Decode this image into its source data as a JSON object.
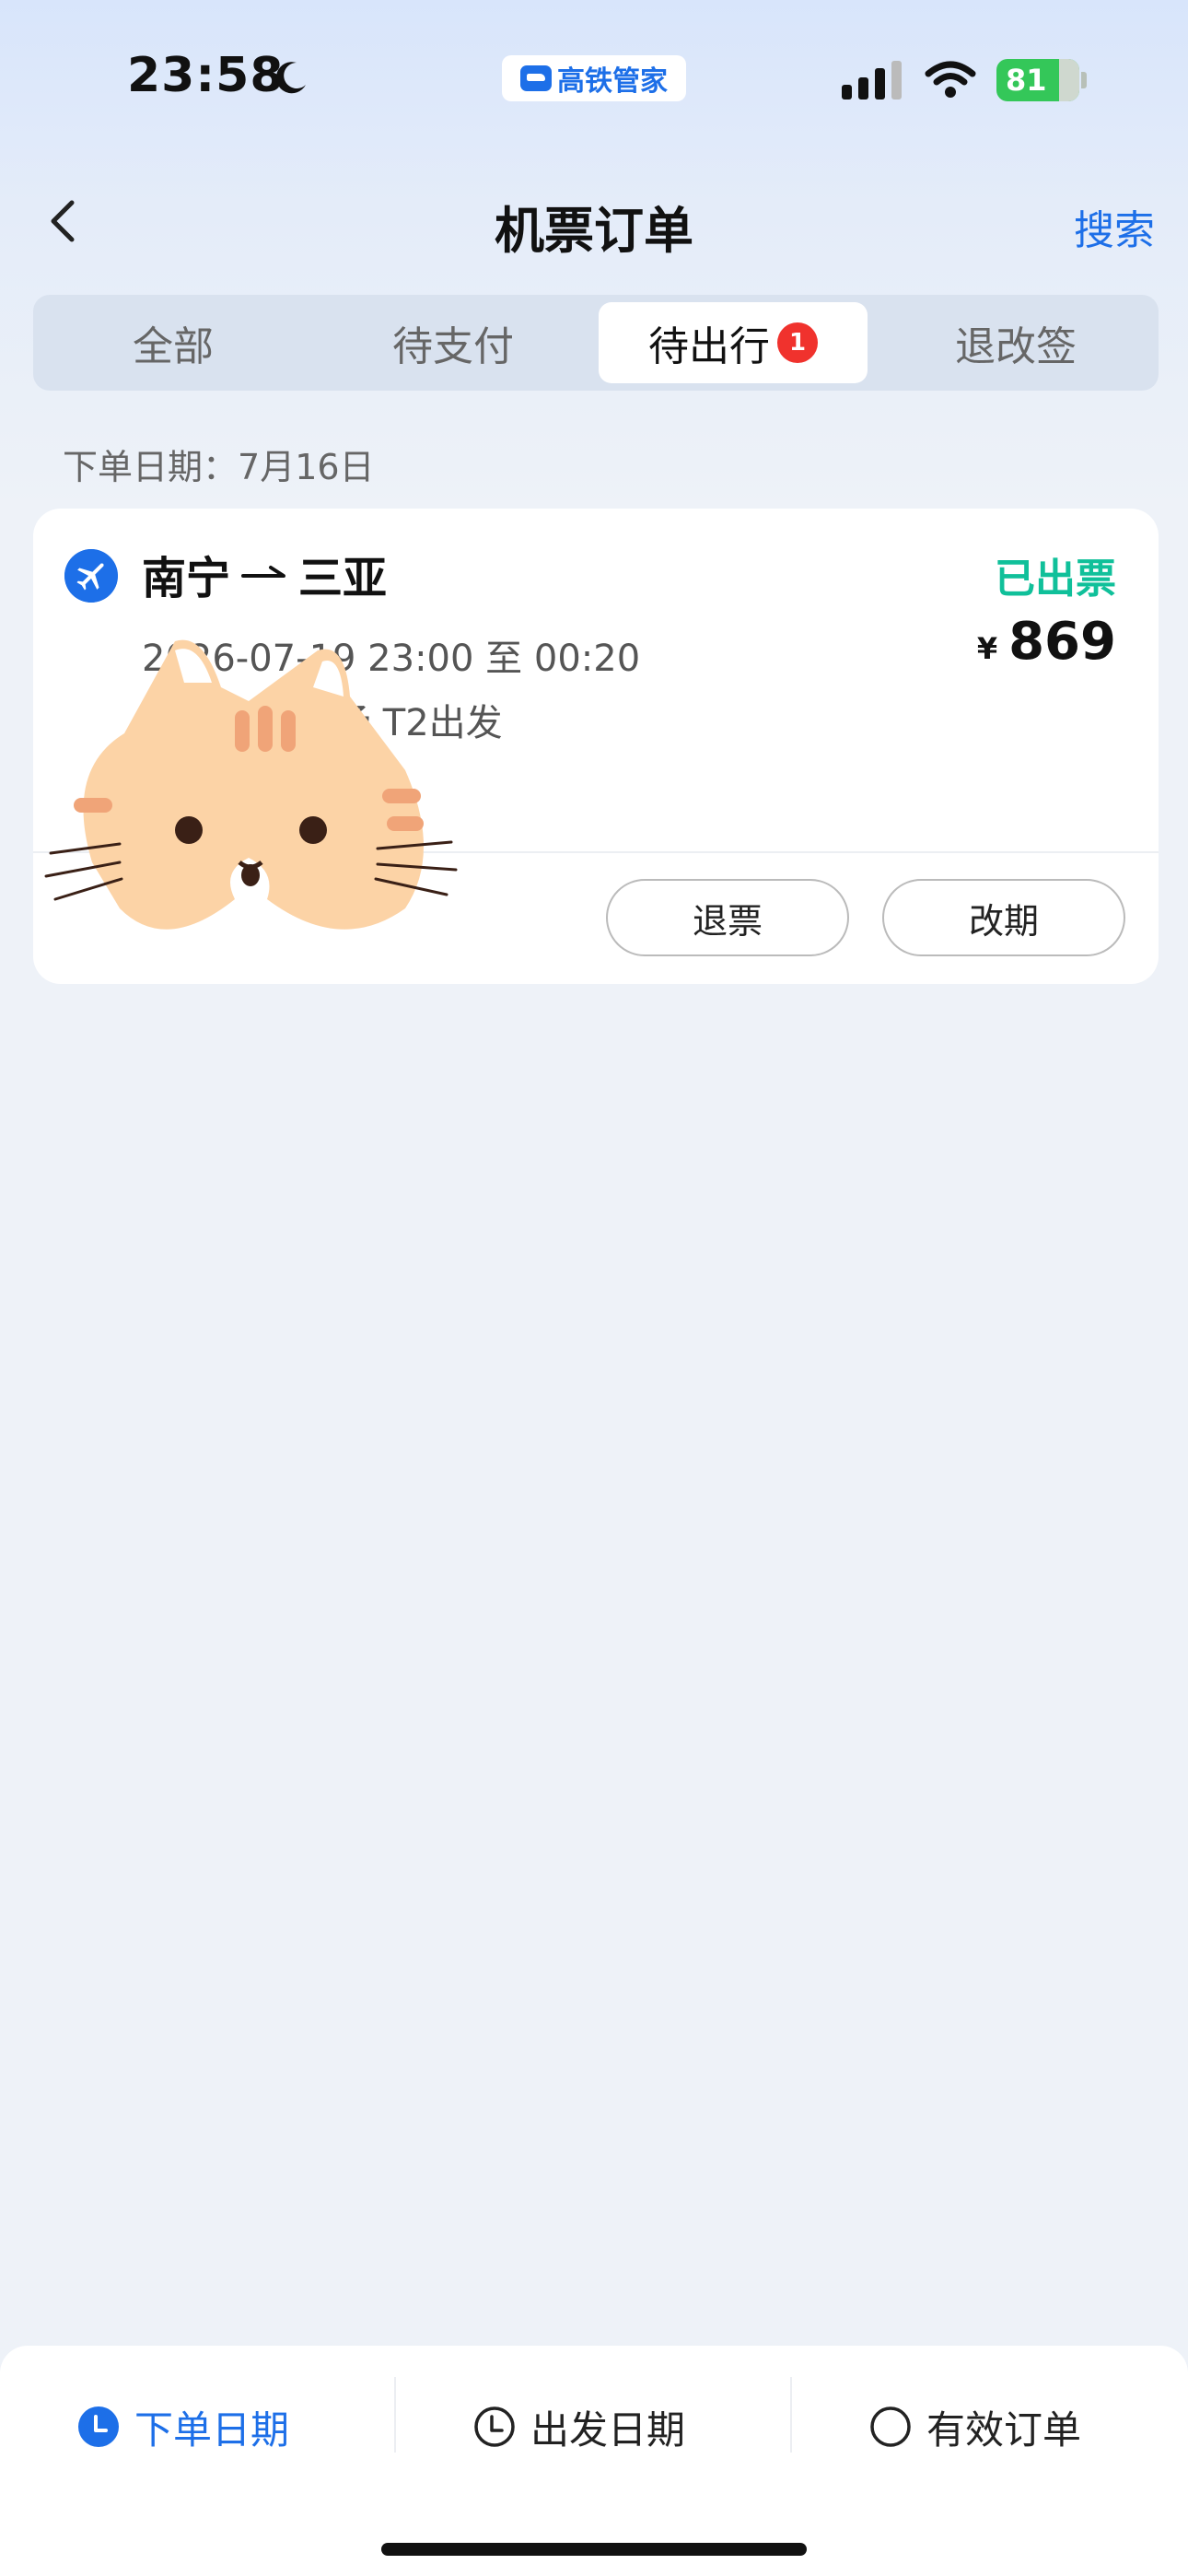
{
  "status_bar": {
    "time": "23:58",
    "app_name": "高铁管家",
    "battery": "81"
  },
  "nav": {
    "title": "机票订单",
    "search_label": "搜索"
  },
  "tabs": [
    {
      "label": "全部"
    },
    {
      "label": "待支付"
    },
    {
      "label": "待出行",
      "badge": "1",
      "active": true
    },
    {
      "label": "退改签"
    }
  ],
  "order_group": {
    "date_prefix": "下单日期：",
    "date": "7月16日"
  },
  "order": {
    "from": "南宁",
    "to": "三亚",
    "status": "已出票",
    "price_currency": "¥",
    "price": "869",
    "time_line": "2026-07-19 23:00 至 00:20",
    "flight_line": "036 吴圩机场 T2出发",
    "refund_label": "退票",
    "change_label": "改期"
  },
  "filters": [
    {
      "label": "下单日期",
      "icon": "clock-filled-icon",
      "active": true
    },
    {
      "label": "出发日期",
      "icon": "clock-outline-icon"
    },
    {
      "label": "有效订单",
      "icon": "circle-outline-icon"
    }
  ],
  "colors": {
    "accent": "#1d6fe8",
    "issued": "#10c09a",
    "badge": "#f0322d"
  }
}
